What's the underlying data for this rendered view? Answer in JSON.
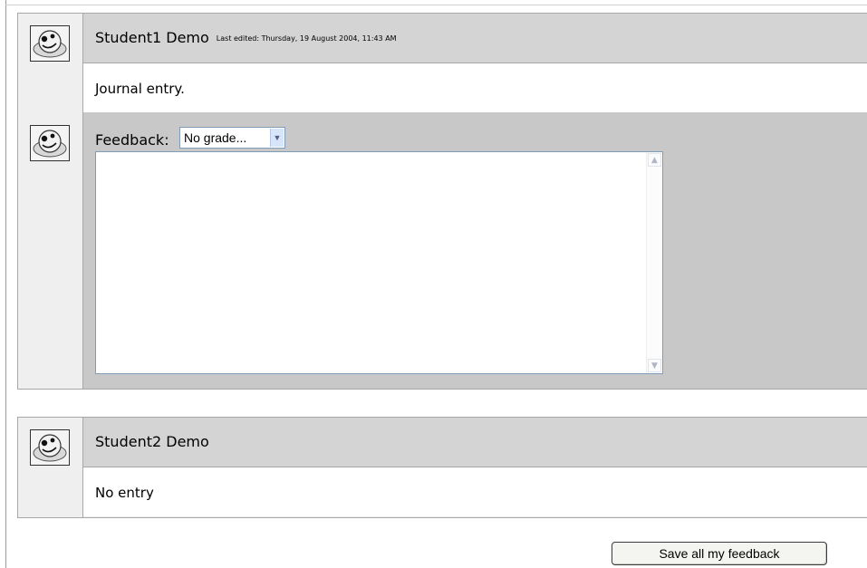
{
  "entries": [
    {
      "student_name": "Student1 Demo",
      "last_edited": "Last edited: Thursday, 19 August 2004, 11:43 AM",
      "content": "Journal entry."
    },
    {
      "student_name": "Student2 Demo",
      "last_edited": "",
      "content": "No entry"
    }
  ],
  "feedback": {
    "label": "Feedback:",
    "grade_value": "No grade...",
    "text": ""
  },
  "icons": {
    "avatar": "smiley-avatar-icon",
    "dropdown": "chevron-down-icon",
    "scroll_up": "scroll-up-arrow-icon",
    "scroll_down": "scroll-down-arrow-icon"
  },
  "actions": {
    "save_label": "Save all my feedback"
  },
  "colors": {
    "header_bg": "#d4d4d4",
    "feedback_bg": "#c8c8c8",
    "side_bg": "#efefef"
  }
}
